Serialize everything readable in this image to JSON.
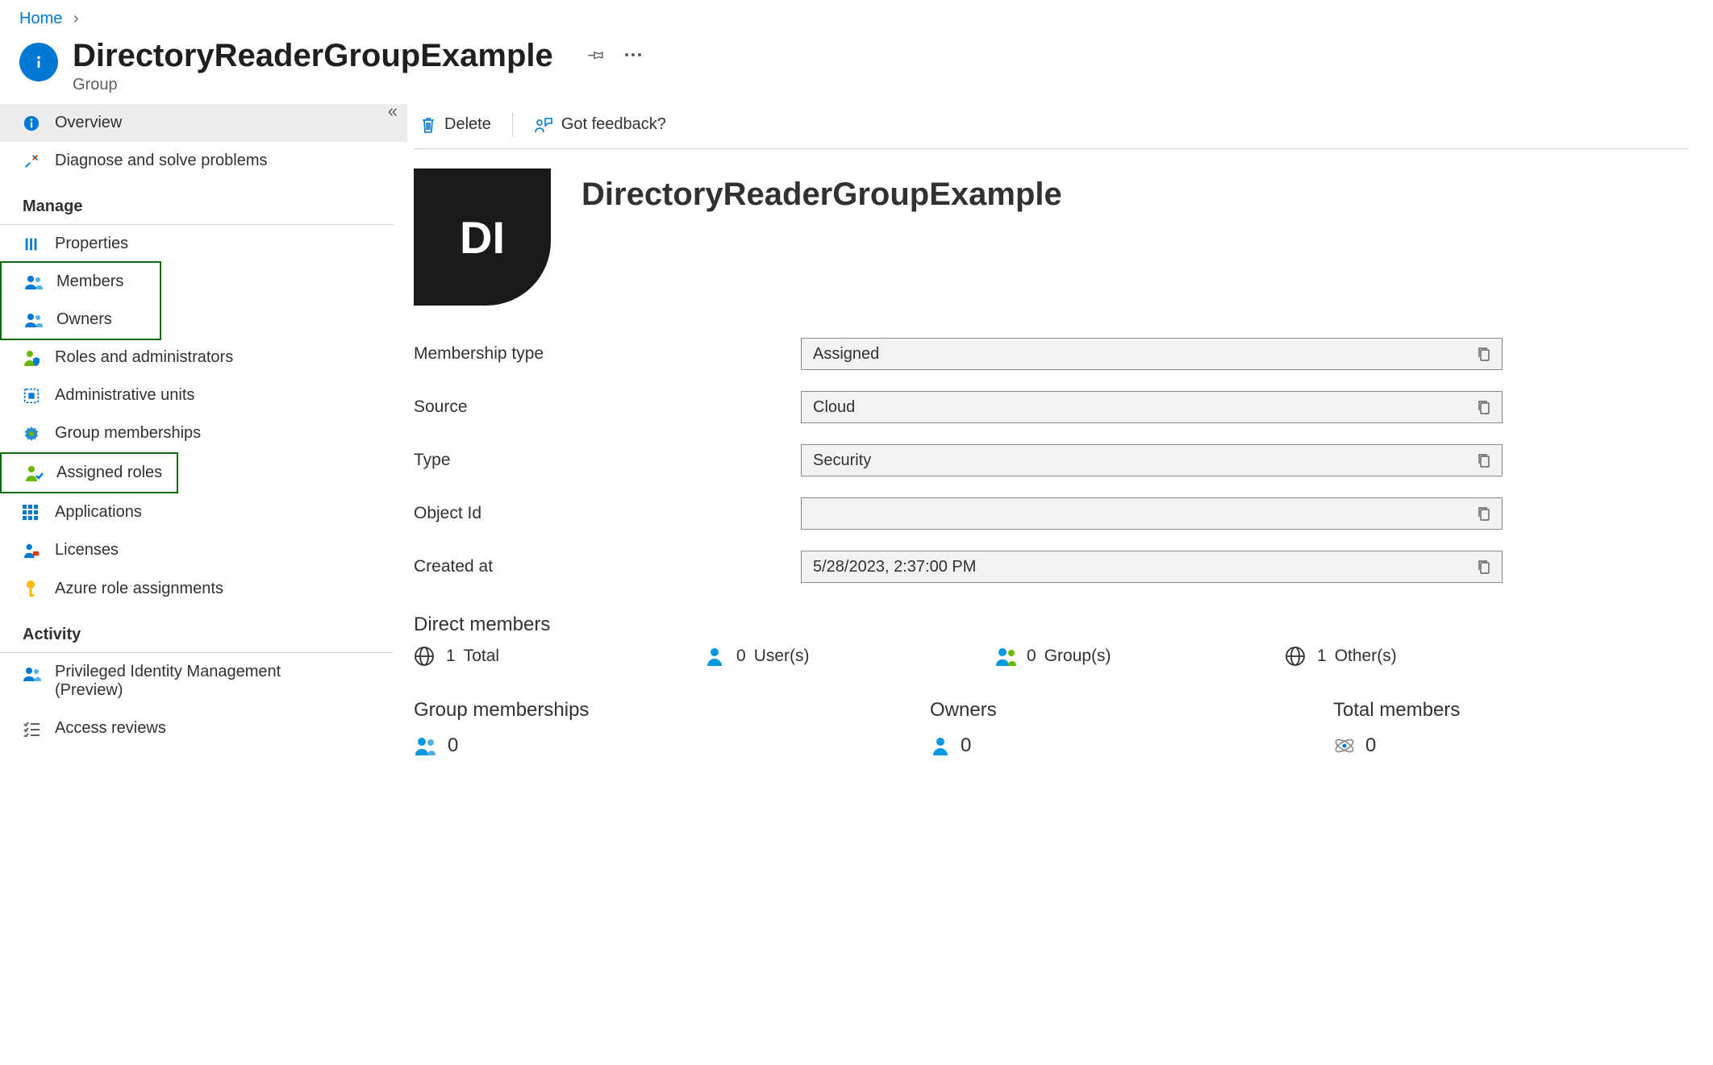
{
  "breadcrumb": {
    "home": "Home"
  },
  "header": {
    "title": "DirectoryReaderGroupExample",
    "subtitle": "Group"
  },
  "sidebar": {
    "items": [
      {
        "label": "Overview"
      },
      {
        "label": "Diagnose and solve problems"
      }
    ],
    "manage_section": "Manage",
    "manage": [
      {
        "label": "Properties"
      },
      {
        "label": "Members"
      },
      {
        "label": "Owners"
      },
      {
        "label": "Roles and administrators"
      },
      {
        "label": "Administrative units"
      },
      {
        "label": "Group memberships"
      },
      {
        "label": "Assigned roles"
      },
      {
        "label": "Applications"
      },
      {
        "label": "Licenses"
      },
      {
        "label": "Azure role assignments"
      }
    ],
    "activity_section": "Activity",
    "activity": [
      {
        "label": "Privileged Identity Management (Preview)"
      },
      {
        "label": "Access reviews"
      }
    ]
  },
  "toolbar": {
    "delete": "Delete",
    "feedback": "Got feedback?"
  },
  "group": {
    "tile": "DI",
    "title": "DirectoryReaderGroupExample"
  },
  "fields": {
    "membership_type": {
      "label": "Membership type",
      "value": "Assigned"
    },
    "source": {
      "label": "Source",
      "value": "Cloud"
    },
    "type": {
      "label": "Type",
      "value": "Security"
    },
    "object_id": {
      "label": "Object Id",
      "value": ""
    },
    "created_at": {
      "label": "Created at",
      "value": "5/28/2023, 2:37:00 PM"
    }
  },
  "direct_members": {
    "title": "Direct members",
    "total": {
      "count": "1",
      "label": "Total"
    },
    "users": {
      "count": "0",
      "label": "User(s)"
    },
    "groups": {
      "count": "0",
      "label": "Group(s)"
    },
    "others": {
      "count": "1",
      "label": "Other(s)"
    }
  },
  "group_memberships": {
    "title": "Group memberships",
    "count": "0"
  },
  "owners": {
    "title": "Owners",
    "count": "0"
  },
  "total_members": {
    "title": "Total members",
    "count": "0"
  }
}
